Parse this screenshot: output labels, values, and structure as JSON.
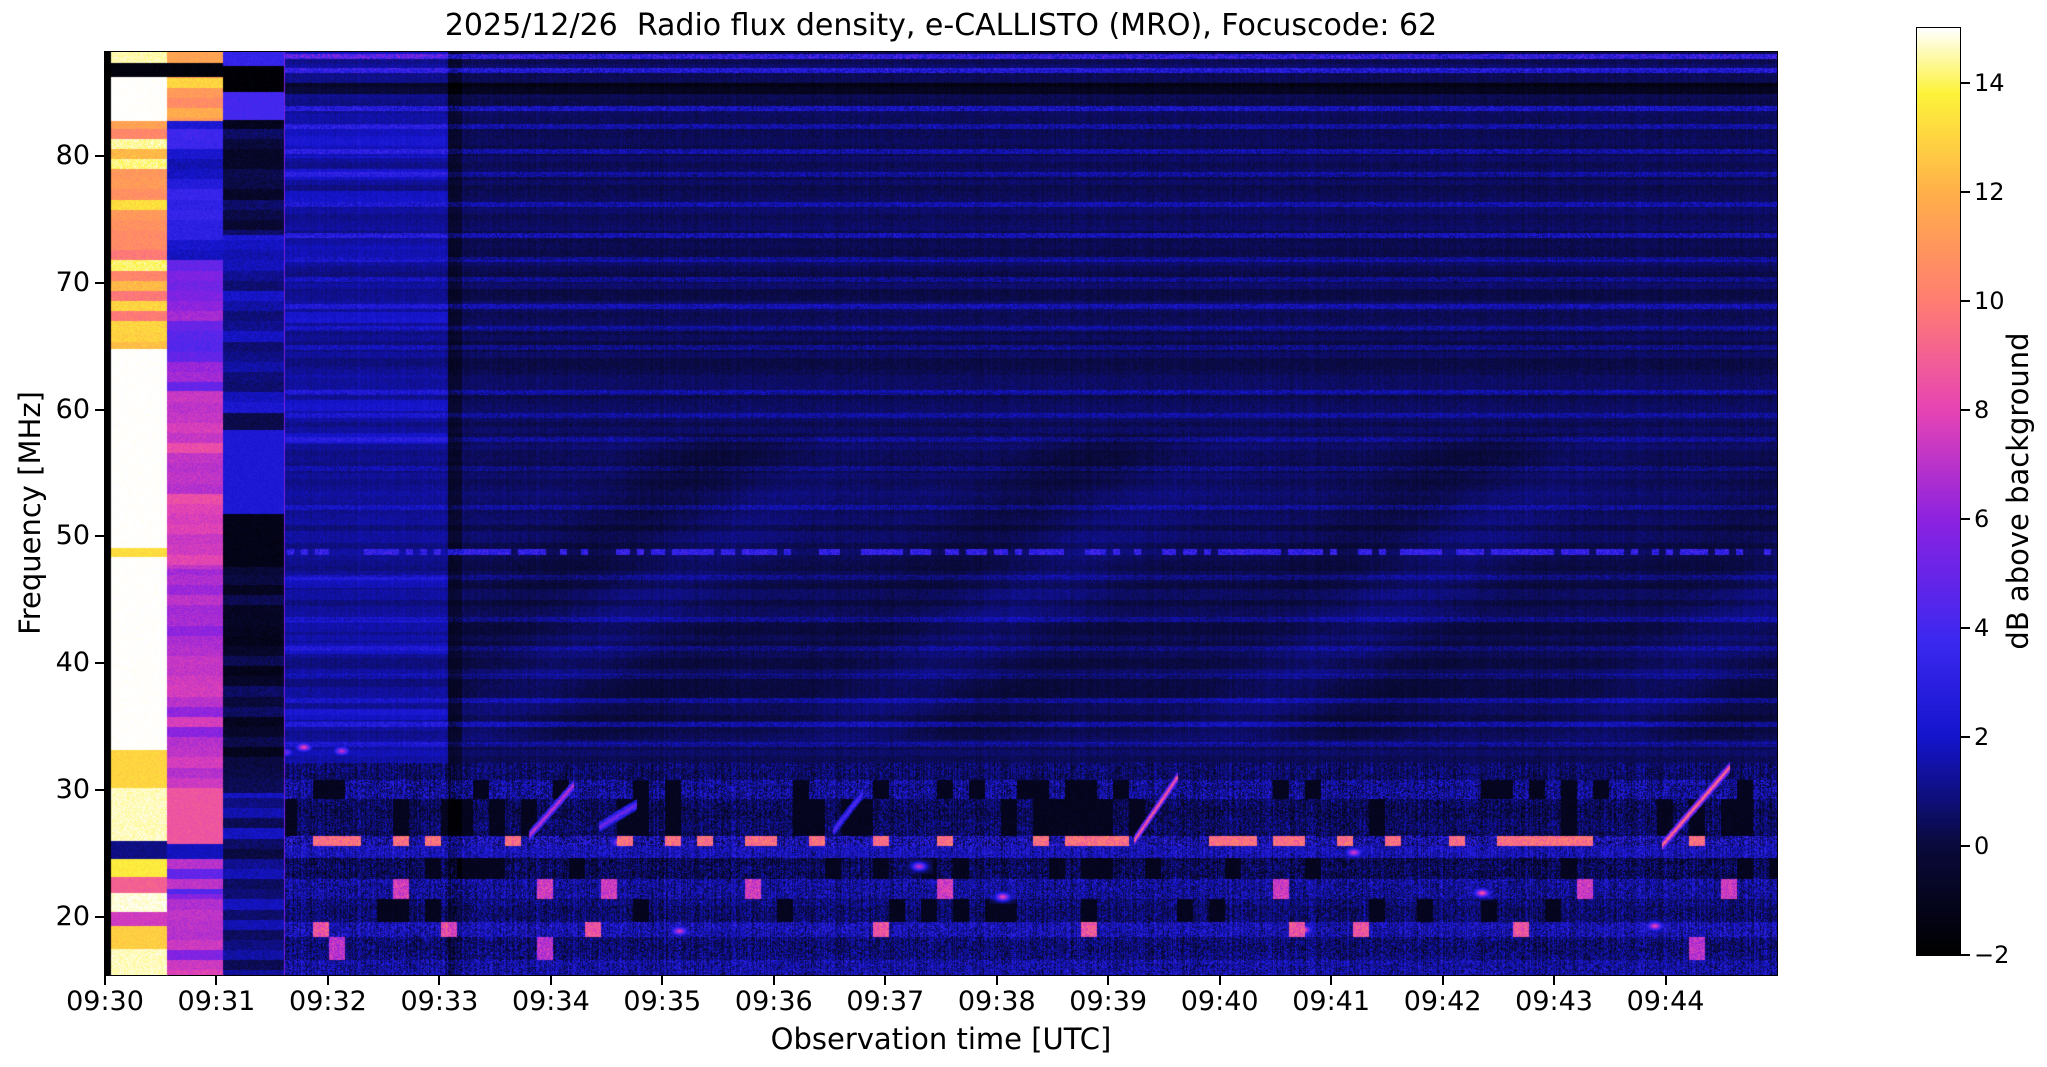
{
  "chart_data": {
    "type": "heatmap",
    "title": "2025/12/26  Radio flux density, e-CALLISTO (MRO), Focuscode: 62",
    "xlabel": "Observation time [UTC]",
    "ylabel": "Frequency [MHz]",
    "colorbar_label": "dB above background",
    "x_start_min": 0,
    "x_end_min": 15,
    "x_ticks": [
      {
        "m": 0,
        "label": "09:30"
      },
      {
        "m": 1,
        "label": "09:31"
      },
      {
        "m": 2,
        "label": "09:32"
      },
      {
        "m": 3,
        "label": "09:33"
      },
      {
        "m": 4,
        "label": "09:34"
      },
      {
        "m": 5,
        "label": "09:35"
      },
      {
        "m": 6,
        "label": "09:36"
      },
      {
        "m": 7,
        "label": "09:37"
      },
      {
        "m": 8,
        "label": "09:38"
      },
      {
        "m": 9,
        "label": "09:39"
      },
      {
        "m": 10,
        "label": "09:40"
      },
      {
        "m": 11,
        "label": "09:41"
      },
      {
        "m": 12,
        "label": "09:42"
      },
      {
        "m": 13,
        "label": "09:43"
      },
      {
        "m": 14,
        "label": "09:44"
      }
    ],
    "freq_min": 15.4,
    "freq_max": 88.2,
    "y_ticks": [
      {
        "v": 80,
        "label": "80"
      },
      {
        "v": 70,
        "label": "70"
      },
      {
        "v": 60,
        "label": "60"
      },
      {
        "v": 50,
        "label": "50"
      },
      {
        "v": 40,
        "label": "40"
      },
      {
        "v": 30,
        "label": "30"
      },
      {
        "v": 20,
        "label": "20"
      }
    ],
    "value_min": -2,
    "value_max": 15,
    "colorbar_ticks": [
      {
        "v": 14,
        "label": "14"
      },
      {
        "v": 12,
        "label": "12"
      },
      {
        "v": 10,
        "label": "10"
      },
      {
        "v": 8,
        "label": "8"
      },
      {
        "v": 6,
        "label": "6"
      },
      {
        "v": 4,
        "label": "4"
      },
      {
        "v": 2,
        "label": "2"
      },
      {
        "v": 0,
        "label": "0"
      },
      {
        "v": -2,
        "label": "−2"
      }
    ],
    "colormap": [
      [
        0.0,
        "#000000"
      ],
      [
        0.118,
        "#0a0a3c"
      ],
      [
        0.235,
        "#1414cc"
      ],
      [
        0.34,
        "#3c28f0"
      ],
      [
        0.47,
        "#8c22e0"
      ],
      [
        0.588,
        "#e644b4"
      ],
      [
        0.705,
        "#ff7d72"
      ],
      [
        0.82,
        "#ffae4a"
      ],
      [
        0.93,
        "#fdf33a"
      ],
      [
        1.0,
        "#ffffff"
      ]
    ],
    "calibration_columns": [
      {
        "t0": 0.0,
        "t1": 0.05,
        "flat": -2
      },
      {
        "t0": 0.05,
        "t1": 0.55,
        "bands": [
          {
            "f0": 87.4,
            "f1": 88.6,
            "v": 14.5
          },
          {
            "f0": 86.3,
            "f1": 87.4,
            "v": -1.5
          },
          {
            "f0": 82.8,
            "f1": 86.3,
            "v": 15.2
          },
          {
            "f0": 64.8,
            "f1": 82.8,
            "lo": 9.8,
            "hi": 14.8
          },
          {
            "f0": 49.1,
            "f1": 64.8,
            "v": 15.2
          },
          {
            "f0": 48.4,
            "f1": 49.1,
            "v": 13.2
          },
          {
            "f0": 33.2,
            "f1": 48.4,
            "v": 15.2
          },
          {
            "f0": 30.2,
            "f1": 33.2,
            "v": 13.0
          },
          {
            "f0": 26.0,
            "f1": 30.2,
            "v": 14.6
          },
          {
            "f0": 24.6,
            "f1": 26.0,
            "v": 1.0
          },
          {
            "f0": 23.2,
            "f1": 24.6,
            "v": 13.6
          },
          {
            "f0": 21.9,
            "f1": 23.2,
            "v": 9.0
          },
          {
            "f0": 20.4,
            "f1": 21.9,
            "v": 14.8
          },
          {
            "f0": 19.3,
            "f1": 20.4,
            "v": 7.5
          },
          {
            "f0": 17.5,
            "f1": 19.3,
            "v": 12.8
          },
          {
            "f0": 15.4,
            "f1": 17.5,
            "v": 14.6
          }
        ]
      },
      {
        "t0": 0.55,
        "t1": 1.05,
        "bands": [
          {
            "f0": 87.4,
            "f1": 88.6,
            "v": 11.5
          },
          {
            "f0": 86.3,
            "f1": 87.4,
            "v": -1.6
          },
          {
            "f0": 82.8,
            "f1": 86.3,
            "lo": 10.0,
            "hi": 13.5
          },
          {
            "f0": 71.8,
            "f1": 82.8,
            "lo": 1.6,
            "hi": 3.9
          },
          {
            "f0": 61.5,
            "f1": 71.8,
            "lo": 4.3,
            "hi": 6.6
          },
          {
            "f0": 47.5,
            "f1": 61.5,
            "lo": 6.6,
            "hi": 8.4
          },
          {
            "f0": 30.2,
            "f1": 47.5,
            "lo": 5.8,
            "hi": 7.8
          },
          {
            "f0": 25.8,
            "f1": 30.2,
            "v": 8.6
          },
          {
            "f0": 24.6,
            "f1": 25.8,
            "v": 1.8
          },
          {
            "f0": 21.8,
            "f1": 24.6,
            "lo": 3.8,
            "hi": 7.2
          },
          {
            "f0": 15.4,
            "f1": 21.8,
            "lo": 5.2,
            "hi": 8.4
          }
        ]
      },
      {
        "t0": 1.05,
        "t1": 1.6,
        "bands": [
          {
            "f0": 87.1,
            "f1": 88.6,
            "v": 3.4
          },
          {
            "f0": 85.1,
            "f1": 87.1,
            "v": -1.8
          },
          {
            "f0": 82.9,
            "f1": 85.1,
            "v": 4.0
          },
          {
            "f0": 73.8,
            "f1": 82.9,
            "lo": -1.3,
            "hi": 0.7
          },
          {
            "f0": 59.8,
            "f1": 73.8,
            "lo": 0.5,
            "hi": 2.3
          },
          {
            "f0": 58.4,
            "f1": 59.8,
            "v": 0.2
          },
          {
            "f0": 51.8,
            "f1": 58.4,
            "v": 2.4
          },
          {
            "f0": 47.6,
            "f1": 51.8,
            "v": -1.2
          },
          {
            "f0": 29.8,
            "f1": 47.6,
            "lo": -1.2,
            "hi": 0.6
          },
          {
            "f0": 15.4,
            "f1": 29.8,
            "lo": 0.0,
            "hi": 2.2
          }
        ]
      }
    ],
    "bright_striped_block": {
      "t0": 1.6,
      "t1": 3.07,
      "boost": 0.75,
      "stripe_boost": 1.1
    },
    "dark_column": {
      "t0": 3.07,
      "t1": 3.2,
      "delta": -0.9
    },
    "pink_vline_t": 1.6,
    "interference_line": {
      "freq": 48.8,
      "t0": 1.55,
      "dash_lo": 2.0,
      "dash_hi": 4.6
    },
    "dark_row_band": {
      "f0": 84.9,
      "f1": 85.8,
      "delta": -1.5
    },
    "bright_rows": [
      [
        88.4,
        2.5
      ],
      [
        87.9,
        3.0
      ],
      [
        86.8,
        2.1
      ],
      [
        83.8,
        1.7
      ],
      [
        82.4,
        1.1
      ],
      [
        80.4,
        1.3
      ],
      [
        78.6,
        1.0
      ],
      [
        76.2,
        1.1
      ],
      [
        73.8,
        1.5
      ],
      [
        71.9,
        0.9
      ],
      [
        70.3,
        1.0
      ],
      [
        68.2,
        1.1
      ],
      [
        66.4,
        0.8
      ],
      [
        64.9,
        0.9
      ],
      [
        61.4,
        1.0
      ],
      [
        59.6,
        0.8
      ],
      [
        57.7,
        0.8
      ],
      [
        55.4,
        0.7
      ],
      [
        52.3,
        0.8
      ],
      [
        46.8,
        0.7
      ],
      [
        43.5,
        0.8
      ],
      [
        41.2,
        0.7
      ],
      [
        39.0,
        0.7
      ],
      [
        37.1,
        0.8
      ],
      [
        35.2,
        0.9
      ],
      [
        33.6,
        0.8
      ]
    ],
    "wave_pattern": {
      "f0": 34,
      "f1": 58,
      "t0": 3.2,
      "amp": 0.25
    },
    "rfi_bands": [
      {
        "f0": 30.8,
        "f1": 32.2,
        "base": 0.5,
        "speckle": 1.2
      },
      {
        "f0": 29.3,
        "f1": 30.8,
        "base": 1.3,
        "speckle": 1.8,
        "gap": 0.25
      },
      {
        "f0": 26.4,
        "f1": 29.3,
        "base": 0.4,
        "speckle": 1.4,
        "gap": 0.3
      },
      {
        "f0": 25.6,
        "f1": 26.4,
        "base": 1.8,
        "speckle": 2.2,
        "burst": 0.32,
        "burst_v": 9.5
      },
      {
        "f0": 24.7,
        "f1": 25.6,
        "base": 2.0,
        "speckle": 1.4
      },
      {
        "f0": 23.0,
        "f1": 24.7,
        "base": 0.3,
        "speckle": 1.5,
        "gap": 0.18
      },
      {
        "f0": 21.4,
        "f1": 23.0,
        "base": 1.5,
        "speckle": 1.6,
        "burst": 0.06,
        "burst_v": 7.5
      },
      {
        "f0": 19.6,
        "f1": 21.4,
        "base": 0.7,
        "speckle": 1.3,
        "gap": 0.15
      },
      {
        "f0": 18.4,
        "f1": 19.6,
        "base": 1.7,
        "speckle": 1.6,
        "burst": 0.1,
        "burst_v": 8.5
      },
      {
        "f0": 16.6,
        "f1": 18.4,
        "base": 0.8,
        "speckle": 1.5,
        "burst": 0.04,
        "burst_v": 7.0
      },
      {
        "f0": 15.4,
        "f1": 16.6,
        "base": 1.6,
        "speckle": 1.6
      }
    ],
    "drifting_bursts": [
      {
        "t0": 9.25,
        "f0": 26.3,
        "t1": 9.6,
        "f1": 30.8,
        "v": 9.5
      },
      {
        "t0": 13.98,
        "f0": 25.8,
        "t1": 14.55,
        "f1": 31.6,
        "v": 10.0
      },
      {
        "t0": 3.82,
        "f0": 26.6,
        "t1": 4.18,
        "f1": 30.2,
        "v": 7.5
      },
      {
        "t0": 4.45,
        "f0": 27.2,
        "t1": 4.75,
        "f1": 28.8,
        "v": 5.5
      },
      {
        "t0": 6.55,
        "f0": 27.0,
        "t1": 6.78,
        "f1": 29.6,
        "v": 4.5
      }
    ],
    "point_bursts": [
      {
        "t": 1.78,
        "f": 33.4,
        "v": 8.0
      },
      {
        "t": 2.12,
        "f": 33.1,
        "v": 7.0
      },
      {
        "t": 1.62,
        "f": 33.0,
        "v": 5.0
      },
      {
        "t": 8.05,
        "f": 21.6,
        "v": 8.0
      },
      {
        "t": 10.75,
        "f": 19.0,
        "v": 8.5
      },
      {
        "t": 12.35,
        "f": 21.9,
        "v": 8.5
      },
      {
        "t": 13.9,
        "f": 19.3,
        "v": 8.0
      },
      {
        "t": 7.3,
        "f": 24.0,
        "v": 7.0
      },
      {
        "t": 5.15,
        "f": 18.9,
        "v": 7.5
      },
      {
        "t": 11.2,
        "f": 25.1,
        "v": 7.5
      },
      {
        "t": 4.62,
        "f": 25.9,
        "v": 9.0
      },
      {
        "t": 6.95,
        "f": 25.9,
        "v": 8.5
      }
    ]
  }
}
